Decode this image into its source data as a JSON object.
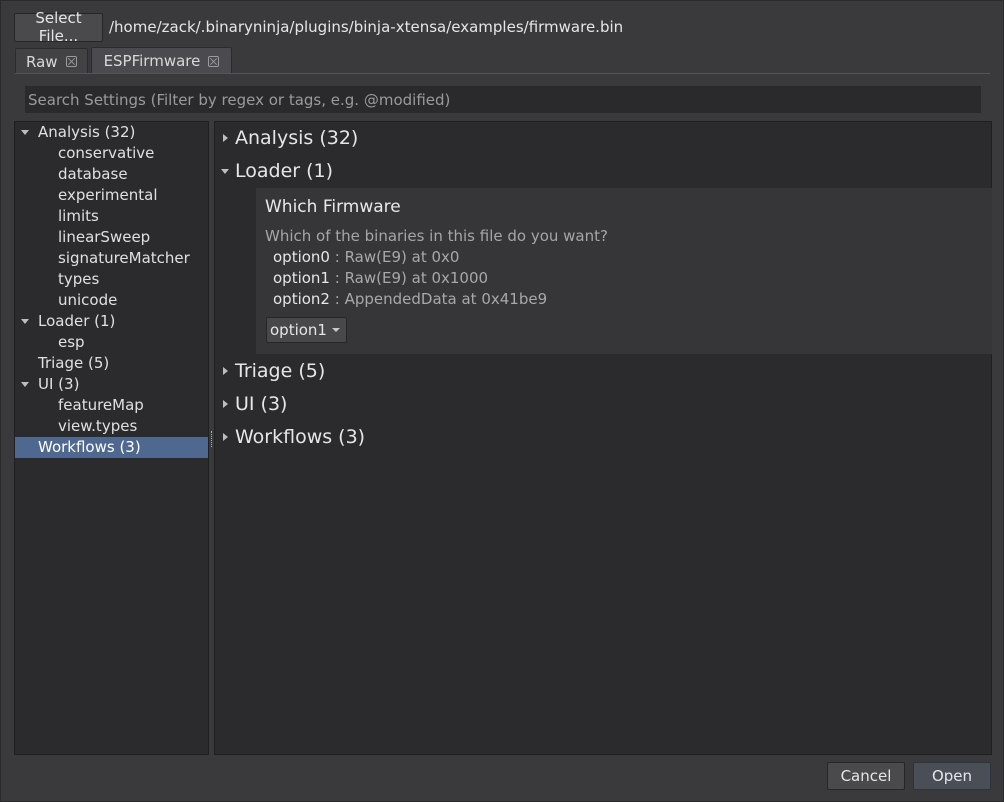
{
  "file": {
    "select_label": "Select File...",
    "path": "/home/zack/.binaryninja/plugins/binja-xtensa/examples/firmware.bin"
  },
  "tabs": [
    {
      "label": "Raw",
      "active": false
    },
    {
      "label": "ESPFirmware",
      "active": true
    }
  ],
  "search": {
    "placeholder": "Search Settings (Filter by regex or tags, e.g. @modified)"
  },
  "tree": {
    "items": [
      {
        "label": "Analysis (32)",
        "expanded": true,
        "level": 0
      },
      {
        "label": "conservative",
        "level": 1
      },
      {
        "label": "database",
        "level": 1
      },
      {
        "label": "experimental",
        "level": 1
      },
      {
        "label": "limits",
        "level": 1
      },
      {
        "label": "linearSweep",
        "level": 1
      },
      {
        "label": "signatureMatcher",
        "level": 1
      },
      {
        "label": "types",
        "level": 1
      },
      {
        "label": "unicode",
        "level": 1
      },
      {
        "label": "Loader (1)",
        "expanded": true,
        "level": 0
      },
      {
        "label": "esp",
        "level": 1
      },
      {
        "label": "Triage (5)",
        "level": 0
      },
      {
        "label": "UI (3)",
        "expanded": true,
        "level": 0
      },
      {
        "label": "featureMap",
        "level": 1
      },
      {
        "label": "view.types",
        "level": 1
      },
      {
        "label": "Workflows (3)",
        "level": 0,
        "selected": true
      }
    ]
  },
  "panel": {
    "sections": [
      {
        "label": "Analysis (32)",
        "expanded": false
      },
      {
        "label": "Loader (1)",
        "expanded": true
      },
      {
        "label": "Triage (5)",
        "expanded": false
      },
      {
        "label": "UI (3)",
        "expanded": false
      },
      {
        "label": "Workflows (3)",
        "expanded": false
      }
    ],
    "setting": {
      "title": "Which Firmware",
      "description": "Which of the binaries in this file do you want?",
      "options": [
        {
          "key": "option0",
          "sep": " : ",
          "value": "Raw(E9) at 0x0"
        },
        {
          "key": "option1",
          "sep": " : ",
          "value": "Raw(E9) at 0x1000"
        },
        {
          "key": "option2",
          "sep": " : ",
          "value": "AppendedData at 0x41be9"
        }
      ],
      "selected": "option1"
    }
  },
  "buttons": {
    "cancel": "Cancel",
    "open": "Open"
  },
  "colors": {
    "selection": "#4f6890",
    "background": "#3a3a3c",
    "panel": "#2b2b2e"
  }
}
